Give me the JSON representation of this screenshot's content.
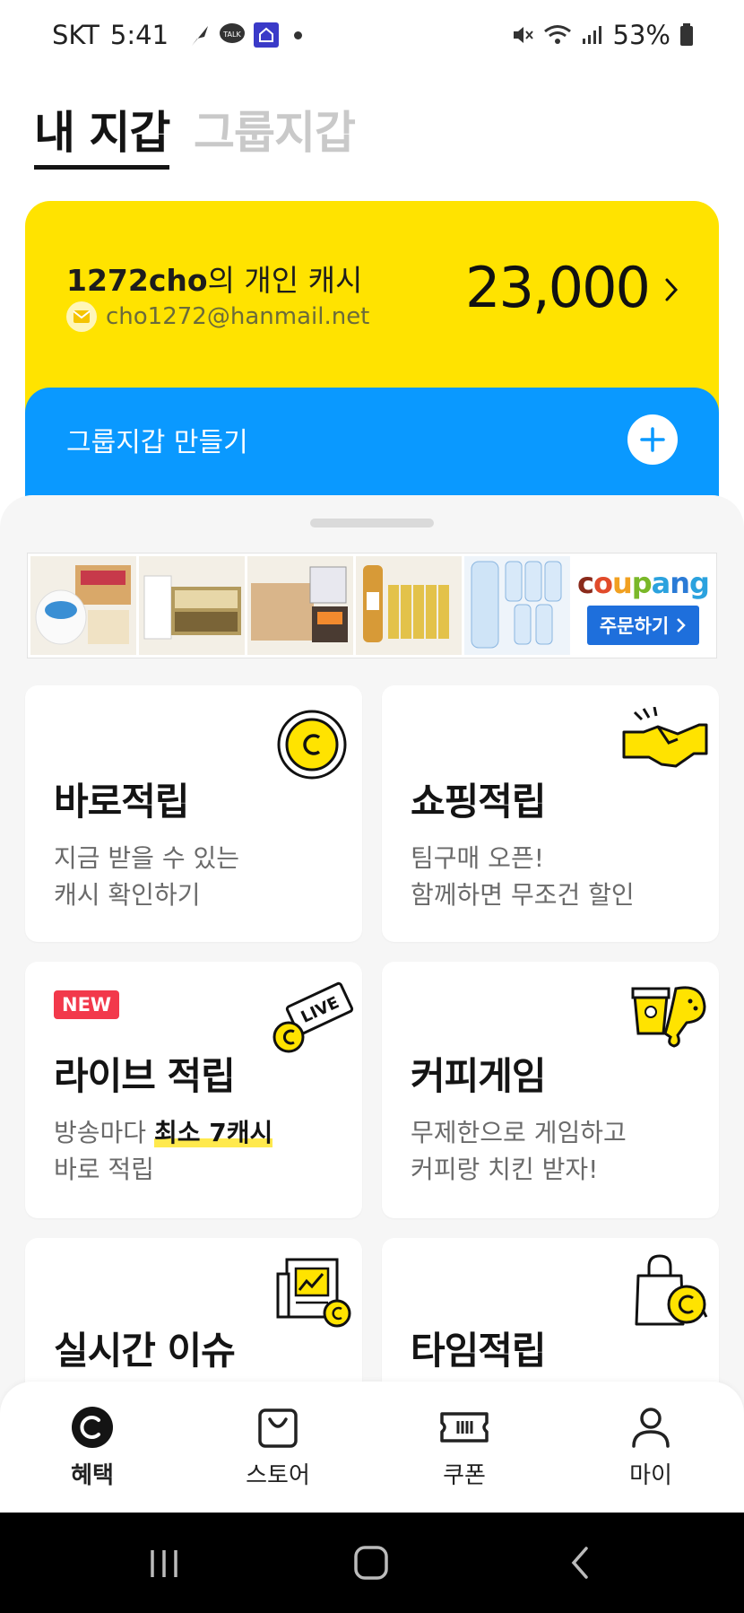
{
  "status_bar": {
    "carrier": "SKT",
    "time": "5:41",
    "battery": "53%"
  },
  "wallet_tabs": {
    "my_wallet": "내 지갑",
    "group_wallet": "그룹지갑"
  },
  "cash_card": {
    "user": "1272cho",
    "suffix": "의 개인 캐시",
    "email": "cho1272@hanmail.net",
    "amount": "23,000"
  },
  "group_card": {
    "label": "그룹지갑 만들기"
  },
  "banner": {
    "brand": "coupang",
    "button": "주문하기"
  },
  "cards": [
    {
      "title": "바로적립",
      "line1": "지금 받을 수 있는",
      "line2": "캐시 확인하기",
      "icon": "coin-icon"
    },
    {
      "title": "쇼핑적립",
      "line1": "팀구매 오픈!",
      "line2": "함께하면 무조건 할인",
      "icon": "handshake-icon"
    },
    {
      "badge": "NEW",
      "title": "라이브 적립",
      "line1_pre": "방송마다 ",
      "line1_hl": "최소 7캐시",
      "line2": "바로 적립",
      "icon": "live-ticket-icon"
    },
    {
      "title": "커피게임",
      "line1": "무제한으로 게임하고",
      "line2": "커피랑 치킨 받자!",
      "icon": "coffee-chicken-icon"
    },
    {
      "title": "실시간 이슈",
      "icon": "news-chart-icon"
    },
    {
      "title": "타임적립",
      "icon": "shopping-bag-timer-icon"
    }
  ],
  "bottom_nav": [
    {
      "label": "혜택",
      "icon": "benefit-coin-icon"
    },
    {
      "label": "스토어",
      "icon": "store-bag-icon"
    },
    {
      "label": "쿠폰",
      "icon": "coupon-ticket-icon"
    },
    {
      "label": "마이",
      "icon": "person-icon"
    }
  ],
  "colors": {
    "yellow": "#ffe300",
    "blue": "#0a99ff",
    "new_badge": "#f2394b",
    "coupang_button": "#1e6fdc"
  }
}
